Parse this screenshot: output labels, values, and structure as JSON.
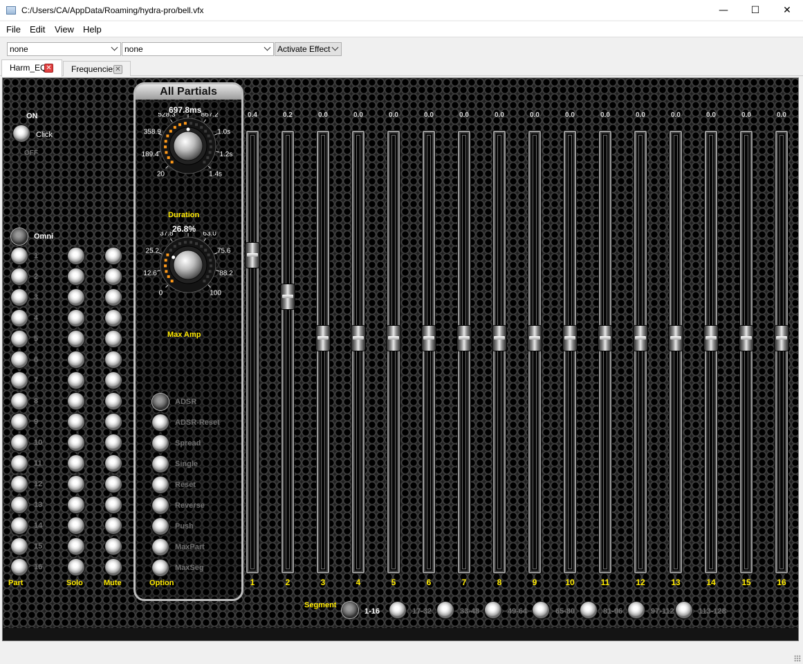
{
  "window": {
    "title": "C:/Users/CA/AppData/Roaming/hydra-pro/bell.vfx",
    "minimize": "—",
    "maximize": "☐",
    "close": "✕"
  },
  "menu": [
    "File",
    "Edit",
    "View",
    "Help"
  ],
  "toolbar": {
    "combo1": "none",
    "combo2": "none",
    "combo3": "Activate Effect"
  },
  "tabs": [
    {
      "label": "Harm_EQ",
      "active": true
    },
    {
      "label": "Frequencies",
      "active": false
    }
  ],
  "power": {
    "on_label": "ON",
    "off_label": "OFF",
    "click_label": "Click"
  },
  "omni_label": "Omni",
  "part_numbers": [
    "1",
    "2",
    "3",
    "4",
    "5",
    "6",
    "7",
    "8",
    "9",
    "10",
    "11",
    "12",
    "13",
    "14",
    "15",
    "16"
  ],
  "column_labels": {
    "part": "Part",
    "solo": "Solo",
    "mute": "Mute",
    "option": "Option"
  },
  "all_partials": {
    "title": "All Partials",
    "duration": {
      "value": "697.8ms",
      "label": "Duration",
      "ticks": [
        "20",
        "189.4",
        "358.9",
        "528.3",
        "697.8",
        "867.2",
        "1.0s",
        "1.2s",
        "1.4s"
      ],
      "level": 0.5
    },
    "max_amp": {
      "value": "26.8%",
      "label": "Max Amp",
      "ticks": [
        "0",
        "12.6",
        "25.2",
        "37.8",
        "50.4",
        "63.0",
        "75.6",
        "88.2",
        "100"
      ],
      "level": 0.268
    }
  },
  "options": [
    "ADSR",
    "ADSR-Reset",
    "Spread",
    "Single",
    "Reset",
    "Reverse",
    "Push",
    "MaxPart",
    "MaxSeg"
  ],
  "sliders": {
    "values": [
      "0.4",
      "0.2",
      "0.0",
      "0.0",
      "0.0",
      "0.0",
      "0.0",
      "0.0",
      "0.0",
      "0.0",
      "0.0",
      "0.0",
      "0.0",
      "0.0",
      "0.0",
      "0.0"
    ],
    "labels": [
      "1",
      "2",
      "3",
      "4",
      "5",
      "6",
      "7",
      "8",
      "9",
      "10",
      "11",
      "12",
      "13",
      "14",
      "15",
      "16"
    ]
  },
  "segment": {
    "label": "Segment",
    "ranges": [
      "1-16",
      "17-32",
      "33-48",
      "49-64",
      "65-80",
      "81-96",
      "97-112",
      "113-128"
    ],
    "selected": "1-16"
  },
  "colors": {
    "accent_yellow": "#ffea00",
    "panel_bg": "#1d1d1d",
    "knob_led": "#ff9a1a"
  }
}
